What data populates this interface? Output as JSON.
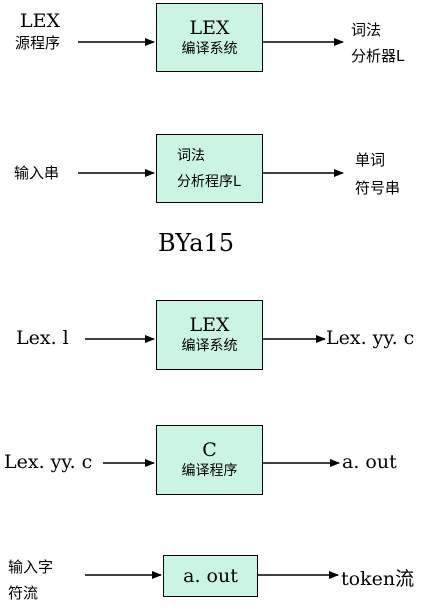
{
  "row1": {
    "left": [
      "LEX",
      "源程序"
    ],
    "box": [
      "LEX",
      "编译系统"
    ],
    "right": [
      "词法",
      "分析器L"
    ]
  },
  "row2": {
    "left": "输入串",
    "box": [
      "词法",
      "分析程序L"
    ],
    "right": [
      "单词",
      "符号串"
    ]
  },
  "middle_label": "BYa15",
  "row3": {
    "left": "Lex. l",
    "box": [
      "LEX",
      "编译系统"
    ],
    "right": "Lex. yy. c"
  },
  "row4": {
    "left": "Lex. yy. c",
    "box": [
      "C",
      "编译程序"
    ],
    "right": "a. out"
  },
  "row5": {
    "left": [
      "输入字",
      "符流"
    ],
    "box": "a. out",
    "right": "token流"
  },
  "colors": {
    "box_fill": "#c9f5e2",
    "line": "#000000"
  }
}
